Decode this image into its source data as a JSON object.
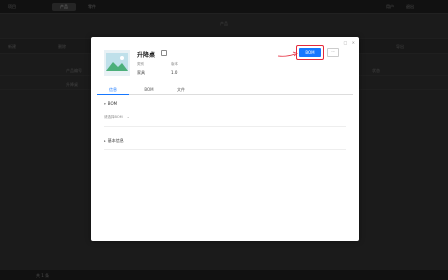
{
  "app": {
    "nav_left": "项目",
    "nav_active": "产品",
    "nav_right": "零件",
    "top_right_1": "用户",
    "top_right_2": "退出",
    "page_title": "产品",
    "toolbar_items": [
      "新建",
      "删除"
    ],
    "toolbar_right": "导出",
    "rows": [
      {
        "c1": "产品编号",
        "c2": "状态"
      },
      {
        "c1": "升降桌",
        "c2": ""
      }
    ],
    "status_left": "共 1 条"
  },
  "modal": {
    "title": "升降桌",
    "meta": [
      {
        "label": "类别",
        "value": "家具"
      },
      {
        "label": "版本",
        "value": "1.0"
      }
    ],
    "primary_button": "BOM",
    "secondary_button": "···",
    "tabs": [
      "信息",
      "BOM",
      "文件"
    ],
    "active_tab": "信息",
    "section_bom": "BOM",
    "select_placeholder": "请选择BOM",
    "section_basic": "基本信息"
  },
  "colors": {
    "primary": "#1677ff",
    "highlight": "#e5293b"
  }
}
